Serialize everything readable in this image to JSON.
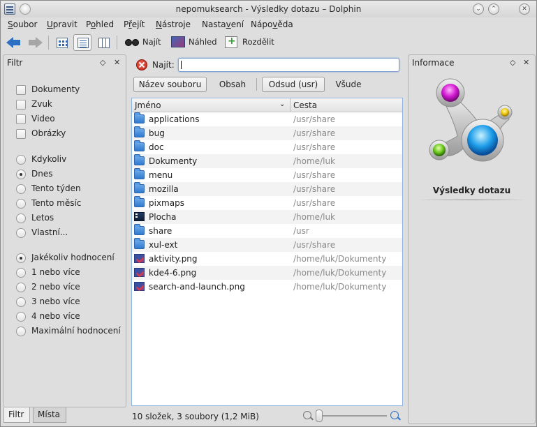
{
  "window": {
    "title": "nepomuksearch - Výsledky dotazu – Dolphin"
  },
  "menu": [
    {
      "pre": "",
      "u": "S",
      "post": "oubor"
    },
    {
      "pre": "",
      "u": "U",
      "post": "pravit"
    },
    {
      "pre": "P",
      "u": "o",
      "post": "hled"
    },
    {
      "pre": "P",
      "u": "ř",
      "post": "ejít"
    },
    {
      "pre": "",
      "u": "N",
      "post": "ástroje"
    },
    {
      "pre": "Nasta",
      "u": "v",
      "post": "ení"
    },
    {
      "pre": "Nápo",
      "u": "v",
      "post": "ěda"
    }
  ],
  "toolbar": {
    "find_label": "Najít",
    "preview_label": "Náhled",
    "split_label": "Rozdělit"
  },
  "filter_panel": {
    "title": "Filtr",
    "types": [
      "Dokumenty",
      "Zvuk",
      "Video",
      "Obrázky"
    ],
    "dates": [
      "Kdykoliv",
      "Dnes",
      "Tento týden",
      "Tento měsíc",
      "Letos",
      "Vlastní..."
    ],
    "ratings": [
      "Jakékoliv hodnocení",
      "1 nebo více",
      "2 nebo více",
      "3 nebo více",
      "4 nebo více",
      "Maximální hodnocení"
    ],
    "tabs": [
      "Filtr",
      "Místa"
    ]
  },
  "search": {
    "label": "Najít:",
    "value": "",
    "buttons": {
      "filename": "Název souboru",
      "content": "Obsah",
      "from_here": "Odsud (usr)",
      "everywhere": "Všude"
    }
  },
  "table": {
    "col_name": "Jméno",
    "col_path": "Cesta",
    "rows": [
      {
        "name": "applications",
        "path": "/usr/share",
        "icon": "folder-icon"
      },
      {
        "name": "bug",
        "path": "/usr/share",
        "icon": "folder-icon"
      },
      {
        "name": "doc",
        "path": "/usr/share",
        "icon": "folder-icon"
      },
      {
        "name": "Dokumenty",
        "path": "/home/luk",
        "icon": "folder-icon"
      },
      {
        "name": "menu",
        "path": "/usr/share",
        "icon": "folder-icon"
      },
      {
        "name": "mozilla",
        "path": "/usr/share",
        "icon": "folder-icon"
      },
      {
        "name": "pixmaps",
        "path": "/usr/share",
        "icon": "folder-icon"
      },
      {
        "name": "Plocha",
        "path": "/home/luk",
        "icon": "desktop-folder-icon"
      },
      {
        "name": "share",
        "path": "/usr",
        "icon": "folder-icon"
      },
      {
        "name": "xul-ext",
        "path": "/usr/share",
        "icon": "folder-icon"
      },
      {
        "name": "aktivity.png",
        "path": "/home/luk/Dokumenty",
        "icon": "image-file-icon"
      },
      {
        "name": "kde4-6.png",
        "path": "/home/luk/Dokumenty",
        "icon": "image-file-icon"
      },
      {
        "name": "search-and-launch.png",
        "path": "/home/luk/Dokumenty",
        "icon": "image-file-icon"
      }
    ]
  },
  "status": {
    "text": "10 složek, 3 soubory (1,2 MiB)",
    "zoom_level": 0
  },
  "info_panel": {
    "title": "Informace",
    "caption": "Výsledky dotazu"
  },
  "colors": {
    "accent": "#2e6fc4",
    "selection_border": "#8fb4e0"
  }
}
